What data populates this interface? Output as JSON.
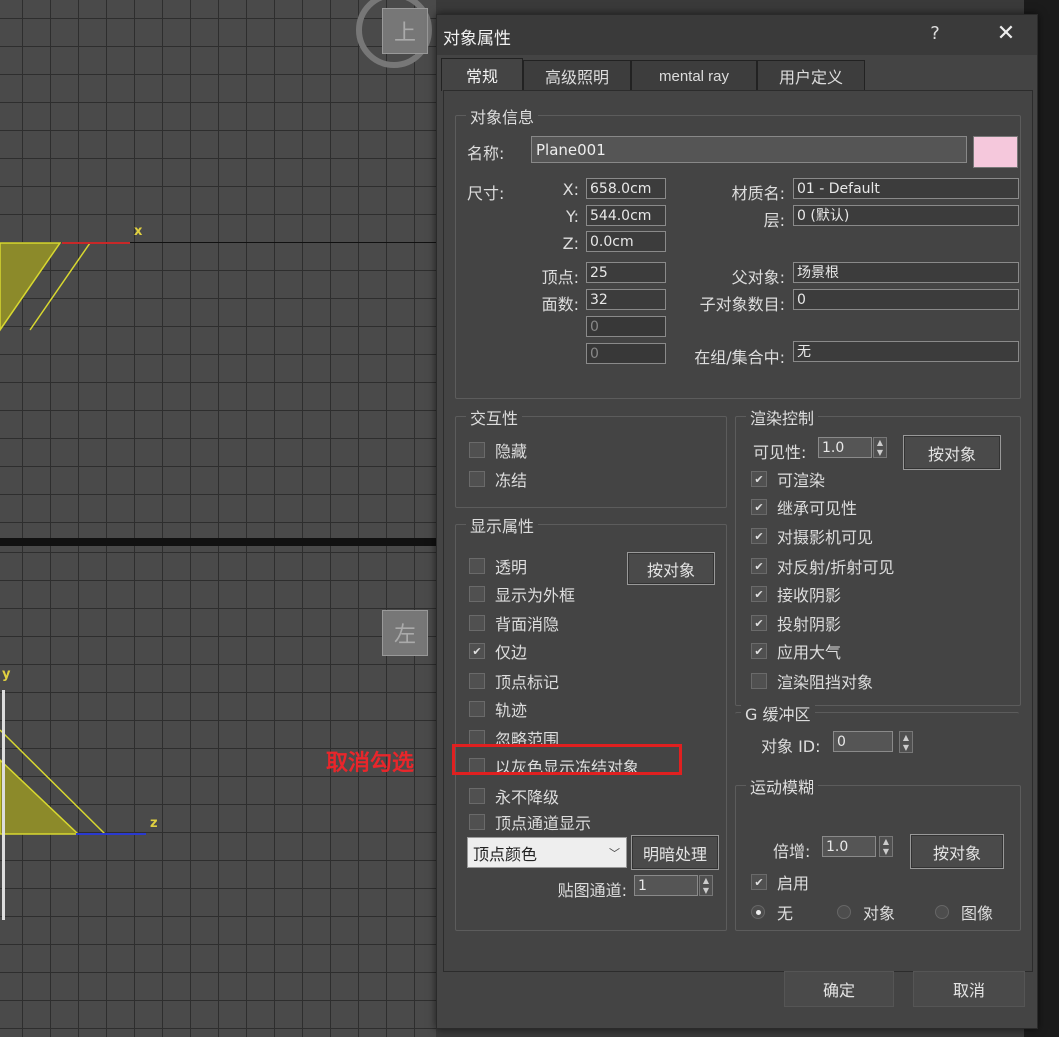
{
  "viewports": {
    "top_axis_x": "x",
    "left_axis_y": "y",
    "left_axis_z": "z",
    "top_cube_label": "上",
    "left_cube_label": "左"
  },
  "dialog": {
    "title": "对象属性",
    "help": "?",
    "close": "✕",
    "tabs": [
      {
        "label": "常规",
        "active": true
      },
      {
        "label": "高级照明",
        "active": false
      },
      {
        "label": "mental ray",
        "active": false
      },
      {
        "label": "用户定义",
        "active": false
      }
    ],
    "object_info": {
      "title": "对象信息",
      "name_label": "名称:",
      "name_value": "Plane001",
      "swatch_color": "#f5c8dc",
      "dimensions_label": "尺寸:",
      "x_label": "X:",
      "x_value": "658.0cm",
      "y_label": "Y:",
      "y_value": "544.0cm",
      "z_label": "Z:",
      "z_value": "0.0cm",
      "vertices_label": "顶点:",
      "vertices_value": "25",
      "faces_label": "面数:",
      "faces_value": "32",
      "extra1_value": "0",
      "extra2_value": "0",
      "material_label": "材质名:",
      "material_value": "01 - Default",
      "layer_label": "层:",
      "layer_value": "0 (默认)",
      "parent_label": "父对象:",
      "parent_value": "场景根",
      "children_label": "子对象数目:",
      "children_value": "0",
      "group_label": "在组/集合中:",
      "group_value": "无"
    },
    "interactivity": {
      "title": "交互性",
      "hide": "隐藏",
      "freeze": "冻结"
    },
    "display_props": {
      "title": "显示属性",
      "by_object_button": "按对象",
      "see_through": "透明",
      "display_as_box": "显示为外框",
      "backface_cull": "背面消隐",
      "edges_only": "仅边",
      "vertex_ticks": "顶点标记",
      "trajectory": "轨迹",
      "ignore_extents": "忽略范围",
      "show_frozen_gray": "以灰色显示冻结对象",
      "never_degrade": "永不降级",
      "vertex_channel_display": "顶点通道显示",
      "vertex_color_select": "顶点颜色",
      "shaded_button": "明暗处理",
      "map_channel_label": "贴图通道:",
      "map_channel_value": "1"
    },
    "render_control": {
      "title": "渲染控制",
      "visibility_label": "可见性:",
      "visibility_value": "1.0",
      "by_object_button": "按对象",
      "renderable": "可渲染",
      "inherit_visibility": "继承可见性",
      "visible_to_camera": "对摄影机可见",
      "visible_to_reflection": "对反射/折射可见",
      "receive_shadows": "接收阴影",
      "cast_shadows": "投射阴影",
      "apply_atmospherics": "应用大气",
      "render_occluded": "渲染阻挡对象"
    },
    "gbuffer": {
      "title": "G 缓冲区",
      "object_id_label": "对象 ID:",
      "object_id_value": "0"
    },
    "motion_blur": {
      "title": "运动模糊",
      "multiplier_label": "倍增:",
      "multiplier_value": "1.0",
      "by_object_button": "按对象",
      "enabled": "启用",
      "none": "无",
      "object": "对象",
      "image": "图像"
    },
    "ok_button": "确定",
    "cancel_button": "取消"
  },
  "annotation": {
    "note": "取消勾选",
    "color": "#e02020"
  }
}
